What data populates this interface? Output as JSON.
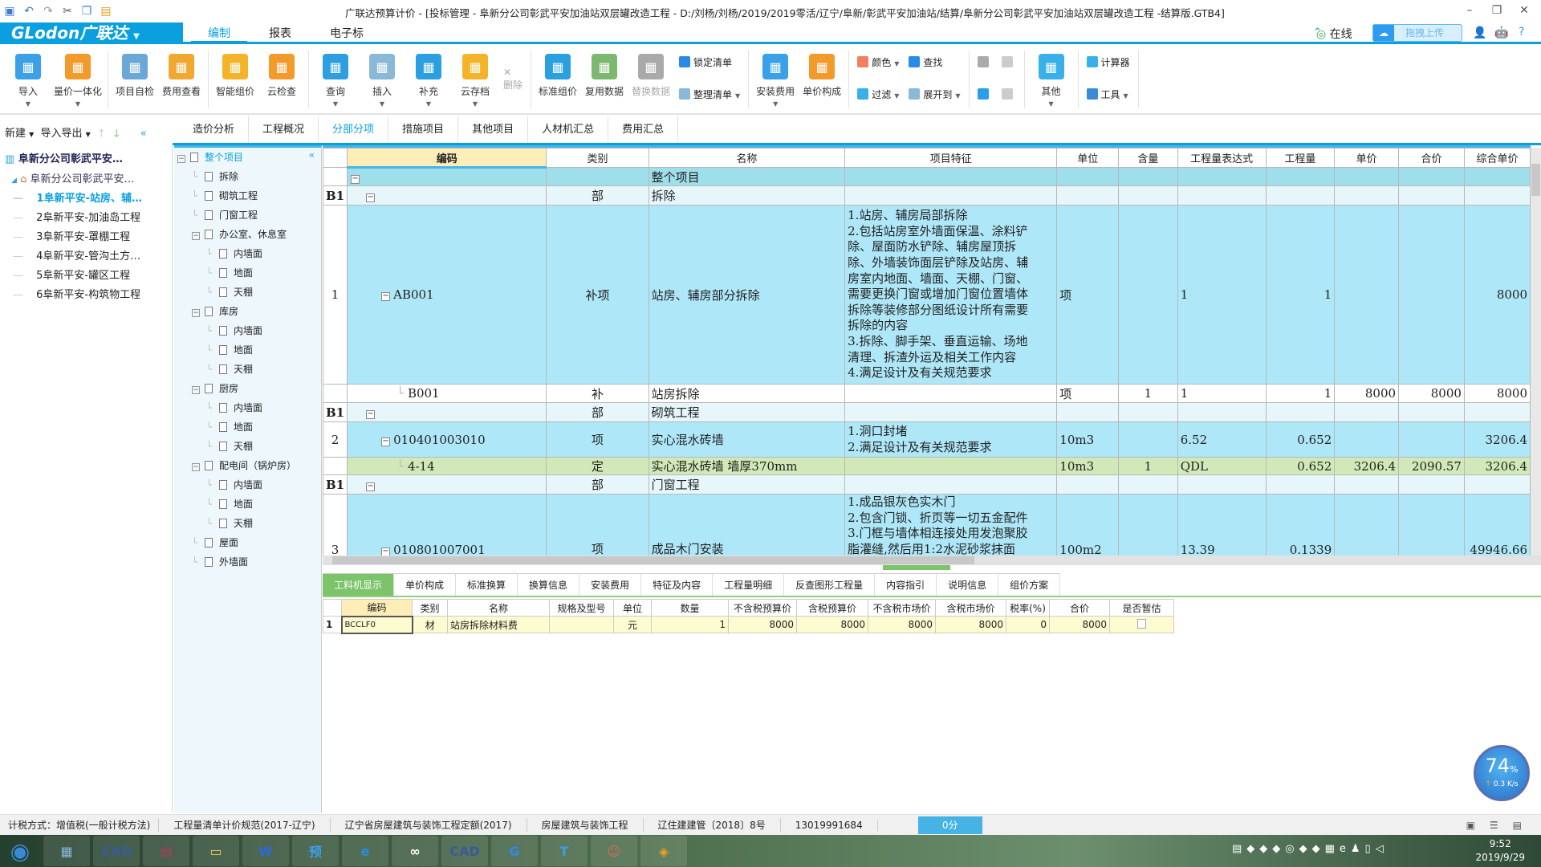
{
  "titlebar": {
    "title": "广联达预算计价 - [投标管理 - 阜新分公司彰武平安加油站双层罐改造工程 - D:/刘杨/刘杨/2019/2019零活/辽宁/阜新/彰武平安加油站/结算/阜新分公司彰武平安加油站双层罐改造工程 -结算版.GTB4]",
    "quick_icons": [
      "save-icon",
      "undo-icon",
      "redo-icon",
      "cut-icon",
      "copy-icon",
      "paste-icon"
    ]
  },
  "menu": {
    "logo": "GLodon广联达",
    "tabs": [
      "编制",
      "报表",
      "电子标"
    ],
    "active": 0,
    "online": "在线",
    "upload": "拖拽上传"
  },
  "toolbar": {
    "groups": [
      [
        {
          "label": "导入",
          "icon": "import-icon",
          "color": "#3aa0e8",
          "dd": true
        },
        {
          "label": "量价一体化",
          "icon": "price-integration-icon",
          "color": "#f39a2b",
          "dd": true
        }
      ],
      [
        {
          "label": "项目自检",
          "icon": "self-check-icon",
          "color": "#6aa8d8"
        },
        {
          "label": "费用查看",
          "icon": "fee-view-icon",
          "color": "#f0a830"
        }
      ],
      [
        {
          "label": "智能组价",
          "icon": "smart-pricing-icon",
          "color": "#f5b32a"
        },
        {
          "label": "云检查",
          "icon": "cloud-check-icon",
          "color": "#f39a2b"
        }
      ],
      [
        {
          "label": "查询",
          "icon": "query-icon",
          "color": "#2f9ee0",
          "dd": true
        },
        {
          "label": "插入",
          "icon": "insert-icon",
          "color": "#8ab8d8",
          "dd": true
        },
        {
          "label": "补充",
          "icon": "supplement-icon",
          "color": "#2aa0e0",
          "dd": true
        },
        {
          "label": "云存档",
          "icon": "cloud-archive-icon",
          "color": "#f5b32a",
          "dd": true
        }
      ]
    ],
    "delete": "删除",
    "group2": [
      {
        "label": "标准组价",
        "icon": "standard-pricing-icon",
        "color": "#2aa0e0"
      },
      {
        "label": "复用数据",
        "icon": "reuse-data-icon",
        "color": "#7cb870"
      },
      {
        "label": "替换数据",
        "icon": "replace-data-icon",
        "color": "#aaaaaa",
        "disabled": true
      }
    ],
    "lock": "锁定清单",
    "organize": "整理清单",
    "group3": [
      {
        "label": "安装费用",
        "icon": "install-fee-icon",
        "color": "#3aa0e8",
        "dd": true
      },
      {
        "label": "单价构成",
        "icon": "unit-price-icon",
        "color": "#f39a2b"
      }
    ],
    "color": "颜色",
    "find": "查找",
    "filter": "过滤",
    "expand": "展开到",
    "other": "其他",
    "calculator": "计算器",
    "tools": "工具"
  },
  "leftbar": {
    "new": "新建",
    "import_export": "导入导出"
  },
  "tabs": [
    "造价分析",
    "工程概况",
    "分部分项",
    "措施项目",
    "其他项目",
    "人材机汇总",
    "费用汇总"
  ],
  "tabs_active": 2,
  "project_tree": {
    "root": "阜新分公司彰武平安…",
    "child": "阜新分公司彰武平安…",
    "items": [
      "1阜新平安-站房、辅…",
      "2阜新平安-加油岛工程",
      "3阜新平安-罩棚工程",
      "4阜新平安-管沟土方…",
      "5阜新平安-罐区工程",
      "6阜新平安-构筑物工程"
    ],
    "active": 0
  },
  "mid_tree": [
    {
      "label": "整个项目",
      "level": 0,
      "toggle": true,
      "active": true
    },
    {
      "label": "拆除",
      "level": 1
    },
    {
      "label": "砌筑工程",
      "level": 1
    },
    {
      "label": "门窗工程",
      "level": 1
    },
    {
      "label": "办公室、休息室",
      "level": 1,
      "toggle": true
    },
    {
      "label": "内墙面",
      "level": 2
    },
    {
      "label": "地面",
      "level": 2
    },
    {
      "label": "天棚",
      "level": 2
    },
    {
      "label": "库房",
      "level": 1,
      "toggle": true
    },
    {
      "label": "内墙面",
      "level": 2
    },
    {
      "label": "地面",
      "level": 2
    },
    {
      "label": "天棚",
      "level": 2
    },
    {
      "label": "厨房",
      "level": 1,
      "toggle": true
    },
    {
      "label": "内墙面",
      "level": 2
    },
    {
      "label": "地面",
      "level": 2
    },
    {
      "label": "天棚",
      "level": 2
    },
    {
      "label": "配电间（锅炉房）",
      "level": 1,
      "toggle": true
    },
    {
      "label": "内墙面",
      "level": 2
    },
    {
      "label": "地面",
      "level": 2
    },
    {
      "label": "天棚",
      "level": 2
    },
    {
      "label": "屋面",
      "level": 1
    },
    {
      "label": "外墙面",
      "level": 1
    }
  ],
  "grid": {
    "headers": [
      "",
      "编码",
      "类别",
      "名称",
      "项目特征",
      "单位",
      "含量",
      "工程量表达式",
      "工程量",
      "单价",
      "合价",
      "综合单价"
    ],
    "rows": [
      {
        "style": "whole",
        "level": 0,
        "toggle": true,
        "num": "",
        "code": "",
        "type": "",
        "name": "整个项目",
        "feature": "",
        "unit": "",
        "content": "",
        "expr": "",
        "qty": "",
        "price": "",
        "total": "",
        "comp": ""
      },
      {
        "style": "section",
        "level": 1,
        "toggle": true,
        "num": "B1",
        "code": "",
        "type": "部",
        "name": "拆除",
        "feature": "",
        "unit": "",
        "content": "",
        "expr": "",
        "qty": "",
        "price": "",
        "total": "",
        "comp": ""
      },
      {
        "style": "item",
        "level": 2,
        "toggle": true,
        "num": "1",
        "code": "AB001",
        "type": "补项",
        "name": "站房、辅房部分拆除",
        "feature": "1.站房、辅房局部拆除\n2.包括站房室外墙面保温、涂料铲\n除、屋面防水铲除、辅房屋顶拆\n除、外墙装饰面层铲除及站房、辅\n房室内地面、墙面、天棚、门窗、\n需要更换门窗或增加门窗位置墙体\n拆除等装修部分图纸设计所有需要\n拆除的内容\n3.拆除、脚手架、垂直运输、场地\n清理、拆渣外运及相关工作内容\n4.满足设计及有关规范要求",
        "unit": "项",
        "content": "",
        "expr": "1",
        "qty": "1",
        "price": "",
        "total": "",
        "comp": "8000"
      },
      {
        "style": "child",
        "level": 3,
        "toggle": false,
        "num": "",
        "code": "B001",
        "type": "补",
        "name": "站房拆除",
        "feature": "",
        "unit": "项",
        "content": "1",
        "expr": "1",
        "qty": "1",
        "price": "8000",
        "total": "8000",
        "comp": "8000"
      },
      {
        "style": "section",
        "level": 1,
        "toggle": true,
        "num": "B1",
        "code": "",
        "type": "部",
        "name": "砌筑工程",
        "feature": "",
        "unit": "",
        "content": "",
        "expr": "",
        "qty": "",
        "price": "",
        "total": "",
        "comp": ""
      },
      {
        "style": "item",
        "level": 2,
        "toggle": true,
        "num": "2",
        "code": "010401003010",
        "type": "项",
        "name": "实心混水砖墙",
        "feature": "1.洞口封堵\n2.满足设计及有关规范要求",
        "unit": "10m3",
        "content": "",
        "expr": "6.52",
        "qty": "0.652",
        "price": "",
        "total": "",
        "comp": "3206.4"
      },
      {
        "style": "quota",
        "level": 3,
        "toggle": false,
        "num": "",
        "code": "4-14",
        "type": "定",
        "name": "实心混水砖墙 墙厚370mm",
        "feature": "",
        "unit": "10m3",
        "content": "1",
        "expr": "QDL",
        "qty": "0.652",
        "price": "3206.4",
        "total": "2090.57",
        "comp": "3206.4"
      },
      {
        "style": "section",
        "level": 1,
        "toggle": true,
        "num": "B1",
        "code": "",
        "type": "部",
        "name": "门窗工程",
        "feature": "",
        "unit": "",
        "content": "",
        "expr": "",
        "qty": "",
        "price": "",
        "total": "",
        "comp": ""
      },
      {
        "style": "item",
        "level": 2,
        "toggle": true,
        "num": "3",
        "code": "010801007001",
        "type": "项",
        "name": "成品木门安装",
        "feature": "1.成品银灰色实木门\n2.包含门锁、折页等一切五金配件\n3.门框与墙体相连接处用发泡聚胶\n脂灌缝,然后用1:2水泥砂浆抹面",
        "unit": "100m2",
        "content": "",
        "expr": "13.39",
        "qty": "0.1339",
        "price": "",
        "total": "",
        "comp": "49946.66"
      }
    ]
  },
  "bottom_tabs": [
    "工料机显示",
    "单价构成",
    "标准换算",
    "换算信息",
    "安装费用",
    "特征及内容",
    "工程量明细",
    "反查图形工程量",
    "内容指引",
    "说明信息",
    "组价方案"
  ],
  "bottom_active": 0,
  "subgrid": {
    "headers": [
      "",
      "编码",
      "类别",
      "名称",
      "规格及型号",
      "单位",
      "数量",
      "不含税预算价",
      "含税预算价",
      "不含税市场价",
      "含税市场价",
      "税率(%)",
      "合价",
      "是否暂估"
    ],
    "rows": [
      {
        "num": "1",
        "code": "BCCLF0",
        "type": "材",
        "name": "站房拆除材料费",
        "spec": "",
        "unit": "元",
        "qty": "1",
        "p1": "8000",
        "p2": "8000",
        "p3": "8000",
        "p4": "8000",
        "tax": "0",
        "total": "8000",
        "provisional": false
      }
    ]
  },
  "gauge": {
    "percent": "74",
    "unit": "%",
    "speed": "0.3 K/s"
  },
  "status": {
    "items": [
      "计税方式：增值税(一般计税方法)",
      "工程量清单计价规范(2017-辽宁)",
      "辽宁省房屋建筑与装饰工程定额(2017)",
      "房屋建筑与装饰工程",
      "辽住建建管〔2018〕8号",
      "13019991684"
    ],
    "score": "0分"
  },
  "taskbar": {
    "apps": [
      {
        "icon": "start-orb-icon",
        "glyph": "◉",
        "color": "#3a8ad8"
      },
      {
        "icon": "calculator-icon",
        "glyph": "▦",
        "color": "#8ab8d8"
      },
      {
        "icon": "cad-icon",
        "glyph": "CAD",
        "color": "#3a5a9a"
      },
      {
        "icon": "winrar-icon",
        "glyph": "▤",
        "color": "#b03a5a"
      },
      {
        "icon": "file-explorer-icon",
        "glyph": "▭",
        "color": "#e8c860"
      },
      {
        "icon": "wps-icon",
        "glyph": "W",
        "color": "#2a6ad8"
      },
      {
        "icon": "glodon-budget-icon",
        "glyph": "预",
        "color": "#3aa0e8"
      },
      {
        "icon": "ie-icon",
        "glyph": "e",
        "color": "#2a8ae8"
      },
      {
        "icon": "baidu-netdisk-icon",
        "glyph": "∞",
        "color": "#ffffff"
      },
      {
        "icon": "cad-icon-2",
        "glyph": "CAD",
        "color": "#3a5a9a"
      },
      {
        "icon": "glodon-app-icon",
        "glyph": "G",
        "color": "#2a8ae8"
      },
      {
        "icon": "text-tool-icon",
        "glyph": "T",
        "color": "#3aa0e8"
      },
      {
        "icon": "avatar-app-icon",
        "glyph": "☺",
        "color": "#d86a5a"
      },
      {
        "icon": "pricing-app-icon",
        "glyph": "◈",
        "color": "#f5a020"
      }
    ],
    "time": "9:52",
    "date": "2019/9/29"
  }
}
